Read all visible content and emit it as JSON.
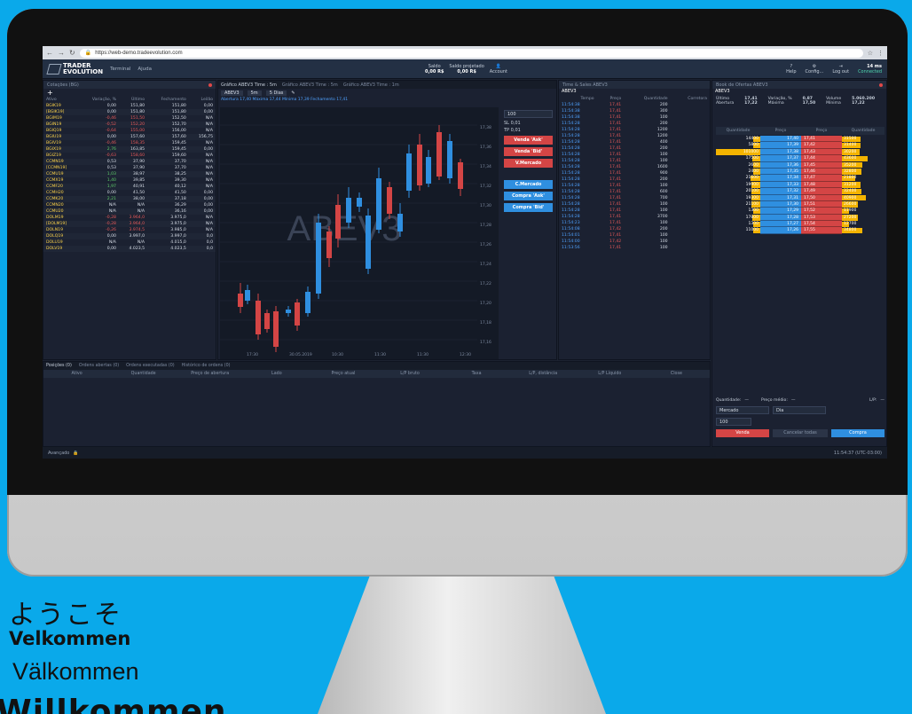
{
  "browser": {
    "url": "https://web-demo.tradeevolution.com"
  },
  "app": {
    "brand_top": "TRADER",
    "brand_bottom": "EVOLUTION",
    "menu": [
      "Terminal",
      "Ajuda"
    ],
    "saldo_label": "Saldo",
    "saldo_value": "0,00 R$",
    "saldo_proj_label": "Saldo projetado",
    "saldo_proj_value": "0,00 R$",
    "account_label": "Account",
    "help": "Help",
    "config": "Config...",
    "logout": "Log out",
    "latency": "14 ms",
    "connected": "Connected"
  },
  "quotes": {
    "title": "Cotações (BG)",
    "headers": [
      "Ativo",
      "Variação, %",
      "Último",
      "Fechamento",
      "Leilão"
    ],
    "rows": [
      [
        "BGIK19",
        "0,00",
        "151,80",
        "151,80",
        "0,00"
      ],
      [
        "[BGIK19]",
        "0,00",
        "151,80",
        "151,80",
        "0,00"
      ],
      [
        "BGIM19",
        "-0,46",
        "151,50",
        "152,50",
        "N/A"
      ],
      [
        "BGIN19",
        "-0,52",
        "152,20",
        "152,70",
        "N/A"
      ],
      [
        "BGIQ19",
        "-0,64",
        "155,00",
        "156,00",
        "N/A"
      ],
      [
        "BGIU19",
        "0,00",
        "157,60",
        "157,60",
        "156,75"
      ],
      [
        "BGIV19",
        "-0,46",
        "158,35",
        "159,45",
        "N/A"
      ],
      [
        "BGIX19",
        "2,76",
        "163,85",
        "159,45",
        "0,00"
      ],
      [
        "BGIZ19",
        "-0,63",
        "158,60",
        "159,60",
        "N/A"
      ],
      [
        "CCMN19",
        "0,53",
        "37,90",
        "37,70",
        "N/A"
      ],
      [
        "[CCMN19]",
        "0,53",
        "37,90",
        "37,70",
        "N/A"
      ],
      [
        "CCMU19",
        "1,03",
        "38,97",
        "38,25",
        "N/A"
      ],
      [
        "CCMX19",
        "1,40",
        "39,85",
        "39,30",
        "N/A"
      ],
      [
        "CCMF20",
        "1,97",
        "40,91",
        "40,12",
        "N/A"
      ],
      [
        "CCMH20",
        "0,00",
        "41,50",
        "41,50",
        "0,00"
      ],
      [
        "CCMK20",
        "2,21",
        "38,00",
        "37,18",
        "0,00"
      ],
      [
        "CCMN20",
        "N/A",
        "N/A",
        "36,29",
        "0,00"
      ],
      [
        "CCMU20",
        "N/A",
        "N/A",
        "36,16",
        "0,00"
      ],
      [
        "DOLM19",
        "-0,28",
        "3.964,0",
        "3.975,0",
        "N/A"
      ],
      [
        "[DOLM19]",
        "-0,28",
        "3.964,0",
        "3.975,0",
        "N/A"
      ],
      [
        "DOLN19",
        "-0,26",
        "3.974,5",
        "3.985,0",
        "N/A"
      ],
      [
        "DOLQ19",
        "0,00",
        "3.997,0",
        "3.997,0",
        "0,0"
      ],
      [
        "DOLU19",
        "N/A",
        "N/A",
        "4.015,0",
        "0,0"
      ],
      [
        "DOLV19",
        "0,00",
        "4.023,5",
        "4.023,5",
        "0,0"
      ]
    ]
  },
  "chart": {
    "tabs": [
      "Gráfico ABEV3 Time : 5m",
      "Gráfico ABEV3 Time : 5m",
      "Gráfico ABEV3 Time : 1m"
    ],
    "symbol": "ABEV3",
    "timeframe": "5m",
    "range": "5 Dias",
    "info": "Abertura 17,40  Máxima 17,44  Mínima 17,39  Fechamento 17,41",
    "watermark": "ABEV3",
    "price_ticks": [
      "17,38",
      "17,36",
      "17,34",
      "17,32",
      "17,30",
      "17,28",
      "17,26",
      "17,24",
      "17,22",
      "17,20",
      "17,18",
      "17,16"
    ],
    "time_ticks": [
      "17:30",
      "30.05.2019",
      "10:30",
      "11:30",
      "11:30",
      "12:30"
    ]
  },
  "trade": {
    "qty": "100",
    "sl": "0,01",
    "tp": "0,01",
    "sell_ask": "Venda 'Ask'",
    "sell_bid": "Venda 'Bid'",
    "sell_mkt": "V.Mercado",
    "buy_mkt": "C.Mercado",
    "buy_ask": "Compra 'Ask'",
    "buy_bid": "Compra 'Bid'"
  },
  "tsales": {
    "title": "Time & Sales ABEV3",
    "symbol": "ABEV3",
    "headers": [
      "Tempo",
      "Preço",
      "Quantidade",
      "Corretora"
    ],
    "rows": [
      [
        "11:54:38",
        "17,41",
        "200"
      ],
      [
        "11:54:38",
        "17,41",
        "300"
      ],
      [
        "11:54:38",
        "17,41",
        "100"
      ],
      [
        "11:54:28",
        "17,41",
        "200"
      ],
      [
        "11:54:28",
        "17,41",
        "1200"
      ],
      [
        "11:54:28",
        "17,41",
        "1200"
      ],
      [
        "11:54:28",
        "17,41",
        "400"
      ],
      [
        "11:54:28",
        "17,41",
        "200"
      ],
      [
        "11:54:28",
        "17,41",
        "100"
      ],
      [
        "11:54:28",
        "17,41",
        "100"
      ],
      [
        "11:54:28",
        "17,41",
        "1600"
      ],
      [
        "11:54:28",
        "17,41",
        "900"
      ],
      [
        "11:54:28",
        "17,41",
        "200"
      ],
      [
        "11:54:28",
        "17,41",
        "100"
      ],
      [
        "11:54:28",
        "17,41",
        "600"
      ],
      [
        "11:54:28",
        "17,41",
        "700"
      ],
      [
        "11:54:28",
        "17,41",
        "100"
      ],
      [
        "11:54:28",
        "17,41",
        "100"
      ],
      [
        "11:54:28",
        "17,41",
        "3700"
      ],
      [
        "11:54:23",
        "17,41",
        "100"
      ],
      [
        "11:54:08",
        "17,42",
        "200"
      ],
      [
        "11:54:01",
        "17,41",
        "100"
      ],
      [
        "11:54:00",
        "17,42",
        "100"
      ],
      [
        "11:53:56",
        "17,41",
        "100"
      ]
    ]
  },
  "book": {
    "title": "Book de Ofertas ABEV3",
    "symbol": "ABEV3",
    "ultimo_label": "Último",
    "ultimo": "17,41",
    "variacao_label": "Variação, %",
    "variacao": "0,87",
    "volume_label": "Volume",
    "volume": "5.060.200",
    "abertura_label": "Abertura",
    "abertura": "17,22",
    "maxima_label": "Máxima",
    "maxima": "17,50",
    "minima_label": "Mínima",
    "minima": "17,22",
    "headers": [
      "Quantidade",
      "Preço",
      "Preço",
      "Quantidade"
    ],
    "rows": [
      [
        14400,
        "17,40",
        "17,41",
        31500
      ],
      [
        5800,
        "17,39",
        "17,42",
        31400
      ],
      [
        101000,
        "17,38",
        "17,43",
        30200
      ],
      [
        17500,
        "17,37",
        "17,44",
        43600
      ],
      [
        2600,
        "17,36",
        "17,45",
        35200
      ],
      [
        2400,
        "17,35",
        "17,46",
        32800
      ],
      [
        21600,
        "17,34",
        "17,47",
        21800
      ],
      [
        19900,
        "17,33",
        "17,48",
        31200
      ],
      [
        20100,
        "17,32",
        "17,49",
        32400
      ],
      [
        19300,
        "17,31",
        "17,50",
        40900
      ],
      [
        21100,
        "17,30",
        "17,51",
        26600
      ],
      [
        1300,
        "17,29",
        "17,52",
        11900
      ],
      [
        17800,
        "17,28",
        "17,53",
        27200
      ],
      [
        1300,
        "17,27",
        "17,54",
        12700
      ],
      [
        11000,
        "17,26",
        "17,55",
        34800
      ]
    ],
    "max_qty": 101000,
    "order": {
      "qty_label": "Quantidade:",
      "avg_label": "Preço médio:",
      "lp_label": "L/P:",
      "type": "Mercado",
      "validity": "Dia",
      "qty": "100",
      "sell": "Venda",
      "cancel": "Cancelar todas",
      "buy": "Compra"
    }
  },
  "positions": {
    "tabs": [
      "Posições (0)",
      "Ordens abertas (0)",
      "Ordens executadas (0)",
      "Histórico de ordens (0)"
    ],
    "headers": [
      "Ativo",
      "Quantidade",
      "Preço de abertura",
      "Lado",
      "Preço atual",
      "L/P bruto",
      "Taxa",
      "L/P, distância",
      "L/P Líquido",
      "Close"
    ]
  },
  "status": {
    "mode": "Avançado",
    "clock": "11:54:37 (UTC-03:00)"
  },
  "welcome": [
    "ようこそ",
    "Velkommen",
    "Välkommen",
    "Willkommen"
  ],
  "colors": {
    "background": "#0aa9ea",
    "bid": "#2f8fe0",
    "ask": "#d44545",
    "volume_bar": "#f4b400"
  }
}
